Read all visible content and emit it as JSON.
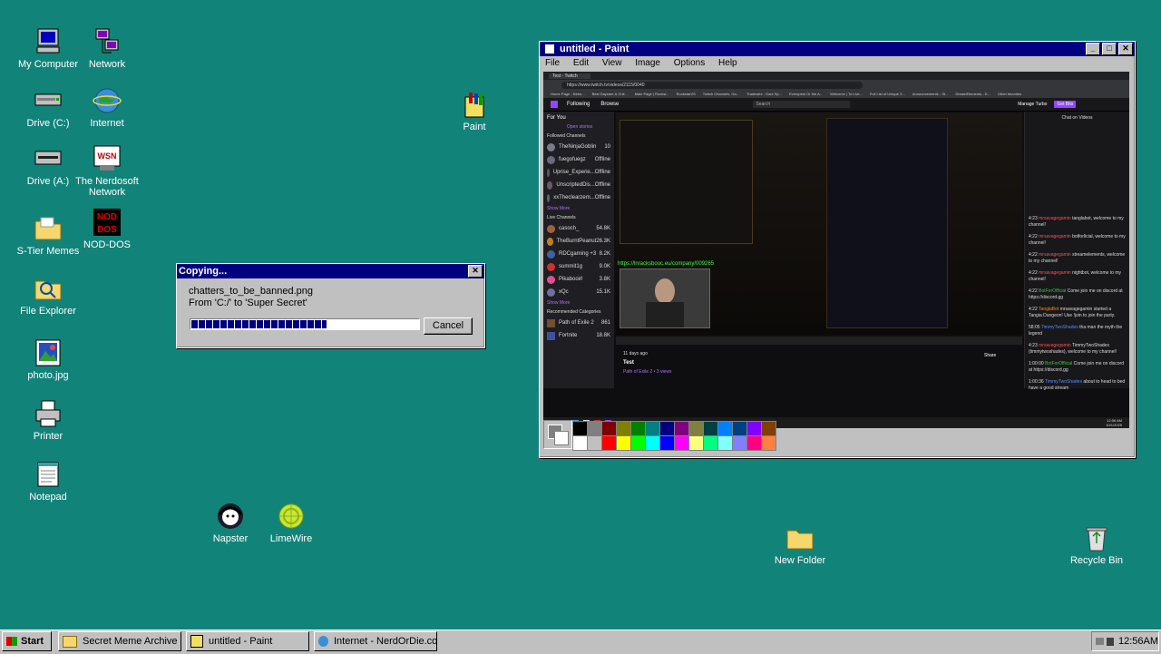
{
  "desktop": {
    "icons": [
      {
        "label": "My Computer",
        "icon": "computer-icon"
      },
      {
        "label": "Network",
        "icon": "network-icon"
      },
      {
        "label": "Drive (C:)",
        "icon": "drive-icon"
      },
      {
        "label": "Internet",
        "icon": "globe-icon"
      },
      {
        "label": "Drive (A:)",
        "icon": "floppy-drive-icon"
      },
      {
        "label": "The Nerdosoft Network",
        "icon": "nerdosoft-icon"
      },
      {
        "label": "S-Tier Memes",
        "icon": "folder-icon"
      },
      {
        "label": "NOD-DOS",
        "icon": "nod-dos-icon"
      },
      {
        "label": "File Explorer",
        "icon": "file-explorer-icon"
      },
      {
        "label": "photo.jpg",
        "icon": "image-file-icon"
      },
      {
        "label": "Printer",
        "icon": "printer-icon"
      },
      {
        "label": "Notepad",
        "icon": "notepad-icon"
      },
      {
        "label": "Napster",
        "icon": "napster-icon"
      },
      {
        "label": "LimeWire",
        "icon": "limewire-icon"
      },
      {
        "label": "Paint",
        "icon": "paint-icon"
      },
      {
        "label": "New Folder",
        "icon": "folder-icon"
      },
      {
        "label": "Recycle Bin",
        "icon": "recycle-bin-icon"
      }
    ]
  },
  "copy_dialog": {
    "title": "Copying...",
    "filename": "chatters_to_be_banned.png",
    "from_to": "From 'C:/' to 'Super Secret'",
    "progress": 0.6,
    "cancel_label": "Cancel"
  },
  "paint": {
    "title": "untitled - Paint",
    "menu": [
      "File",
      "Edit",
      "View",
      "Image",
      "Options",
      "Help"
    ],
    "palette_top": [
      "#000000",
      "#808080",
      "#800000",
      "#808000",
      "#008000",
      "#008080",
      "#000080",
      "#800080",
      "#808040",
      "#004040",
      "#0080ff",
      "#004080",
      "#8000ff",
      "#804000"
    ],
    "palette_bottom": [
      "#ffffff",
      "#c0c0c0",
      "#ff0000",
      "#ffff00",
      "#00ff00",
      "#00ffff",
      "#0000ff",
      "#ff00ff",
      "#ffff80",
      "#00ff80",
      "#80ffff",
      "#8080ff",
      "#ff0080",
      "#ff8040"
    ],
    "canvas": {
      "browser_tab": "Test - Twitch",
      "url": "https://www.twitch.tv/videos/2115/0040",
      "bookmarks": [
        "Home Page - Nebo...",
        "Best Daycare & Chil...",
        "Main Page | Rockst...",
        "RockstarVS",
        "Twitch Channels, Ga...",
        "Tradewire - Dark Sp...",
        "Everquest Or the A...",
        "Welcome | To Live...",
        "Full List of Unique Z...",
        "Announcements - St...",
        "DreamElements - D...",
        "Other favorites"
      ],
      "twitch_nav": [
        "Following",
        "Browse"
      ],
      "search_placeholder": "Search",
      "manage_turbo": "Manage Turbo",
      "get_bits": "Get Bits",
      "for_you": "For You",
      "open_stories": "Open stories",
      "followed_header": "Followed Channels",
      "followed": [
        {
          "name": "TheNinjaGoblin",
          "status": "10"
        },
        {
          "name": "fuegofuegz",
          "status": "Offline"
        },
        {
          "name": "Uprise_Experie...",
          "status": "Offline"
        },
        {
          "name": "UnscriptedDis...",
          "status": "Offline"
        },
        {
          "name": "xxTheclearzem...",
          "status": "Offline"
        }
      ],
      "show_more": "Show More",
      "live_header": "Live Channels",
      "live": [
        {
          "name": "casoch_",
          "status": "54.8K"
        },
        {
          "name": "TheBurntPeanut",
          "status": "26.3K"
        },
        {
          "name": "RDCgaming +3",
          "status": "8.2K"
        },
        {
          "name": "summit1g",
          "status": "9.0K"
        },
        {
          "name": "Pikabooirl",
          "status": "3.8K"
        },
        {
          "name": "xQc",
          "status": "15.1K"
        }
      ],
      "recommended_header": "Recommended Categories",
      "recommended": [
        {
          "name": "Path of Exile 2",
          "status": "861"
        },
        {
          "name": "Fortnite",
          "status": "18.8K"
        }
      ],
      "overlay_url": "https://lnracksbooc.eu/company/009265",
      "video_age": "11 days ago",
      "video_title": "Test",
      "video_meta": "Path of Exile 2 • 3 views",
      "share_label": "Share",
      "chat_header": "Chat on Videos",
      "chat": [
        {
          "time": "4:23",
          "user": "mrsavagegamin",
          "msg": "tanglabot, welcome to my channel!"
        },
        {
          "time": "4:22",
          "user": "mrsavagegamin",
          "msg": "botforlicial, welcome to my channel!"
        },
        {
          "time": "4:22",
          "user": "mrsavagegamin",
          "msg": "streamelements, welcome to my channel!"
        },
        {
          "time": "4:22",
          "user": "mrsavagegamin",
          "msg": "nightbot, welcome to my channel!"
        },
        {
          "time": "4:22",
          "user": "BotForOfficial",
          "msg": "Come join me on discord at https://discord.gg"
        },
        {
          "time": "4:22",
          "user": "TanglaBot",
          "msg": "mrsavagegamin started a Tangia Dungeon! Use !join to join the party."
        },
        {
          "time": "58:05",
          "user": "TimmyTwoShades",
          "msg": "tha man the myth the legend"
        },
        {
          "time": "4:23",
          "user": "mrsavagegamin",
          "msg": "TimmyTwoShades (timmytwoshades), welcome to my channel!"
        },
        {
          "time": "1:00:00",
          "user": "BotForOfficial",
          "msg": "Come join me on discord at https://discord.gg"
        },
        {
          "time": "1:00:36",
          "user": "TimmyTwoShades",
          "msg": "about to head to bed have a good stream"
        }
      ],
      "clock_time": "12:56 AM",
      "clock_date": "10/1/2025"
    }
  },
  "taskbar": {
    "start_label": "Start",
    "items": [
      {
        "label": "Secret Meme Archive",
        "icon": "folder-icon"
      },
      {
        "label": "untitled - Paint",
        "icon": "paint-icon"
      },
      {
        "label": "Internet - NerdOrDie.com",
        "icon": "globe-icon"
      }
    ],
    "clock": "12:56AM"
  }
}
